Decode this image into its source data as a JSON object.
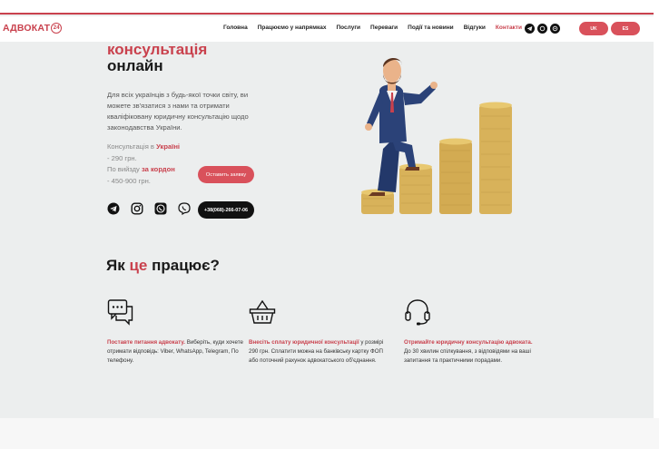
{
  "brand": {
    "name": "АДВОКАТ",
    "mark": "24"
  },
  "nav": {
    "items": [
      "Головна",
      "Працюємо у напрямках",
      "Послуги",
      "Переваги",
      "Події та новини",
      "Відгуки",
      "Контакти"
    ],
    "active": "Контакти"
  },
  "header_socials": [
    "telegram-icon",
    "viber-icon",
    "whatsapp-icon"
  ],
  "lang": {
    "first": "UK",
    "second": "ES"
  },
  "hero": {
    "title_line1": "консультація",
    "title_line2": "онлайн",
    "description": "Для всіх українців з будь-якої точки світу, ви можете зв'язатися з нами та отримати кваліфіковану юридичну консультацію щодо законодавства України.",
    "price1_prefix": "Консультація в ",
    "price1_place": "Україні",
    "price1_value": "- 290 грн.",
    "price2_prefix": "По вийзду ",
    "price2_place": "за кордон",
    "price2_value": "- 450-900 грн.",
    "order_button": "Оставить заявку",
    "phone": "+38(068)-266-07-06",
    "contact_icons": [
      "telegram-icon",
      "instagram-icon",
      "whatsapp-icon",
      "viber-icon"
    ]
  },
  "how": {
    "title_before": "Як ",
    "title_accent": "це",
    "title_after": " працює?",
    "steps": [
      {
        "icon": "chat-icon",
        "accent": "Поставте питання адвокату.",
        "text": " Виберіть, куди хочете отримати відповідь: Viber, WhatsApp, Telegram, По телефону."
      },
      {
        "icon": "basket-icon",
        "accent": "Внесіть сплату юридичної консультації",
        "text": " у розмірі 290 грн. Сплатити можна на банківську картку ФОП або поточний рахунок адвокатського об'єднання."
      },
      {
        "icon": "headset-icon",
        "accent": "Отримайте юридичну консультацію адвоката.",
        "text": " До 30 хвилин спілкування, з відповідями на ваші запитання та практичними порадами."
      }
    ]
  },
  "colors": {
    "accent": "#c9414d",
    "button": "#d9515b",
    "background": "#eceeee",
    "coin": "#d8b25a"
  }
}
